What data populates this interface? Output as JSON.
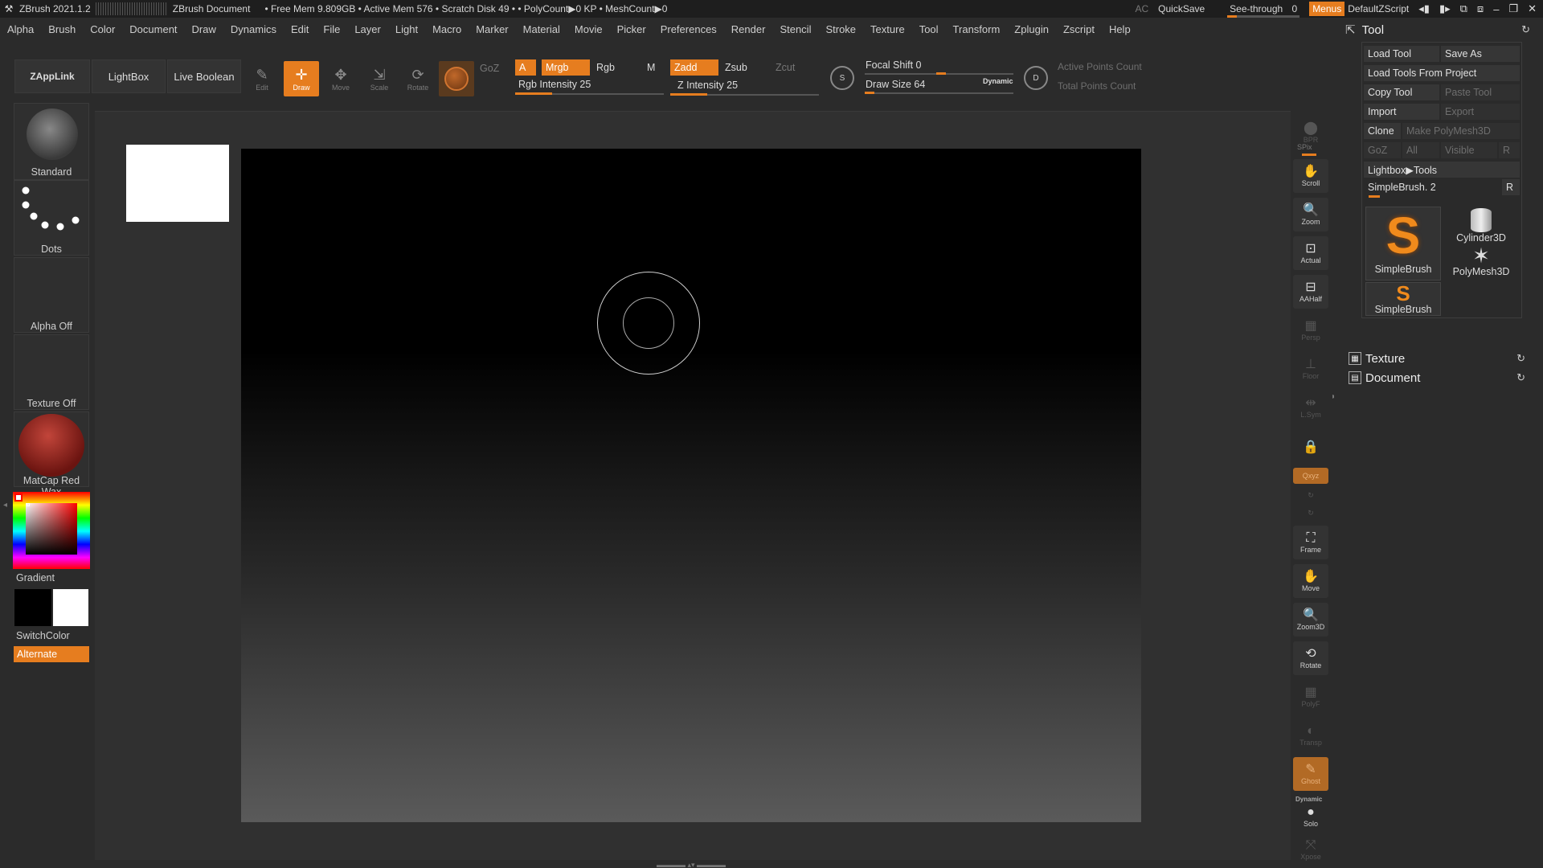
{
  "titlebar": {
    "app": "ZBrush 2021.1.2",
    "document": "ZBrush Document",
    "stats": "• Free Mem 9.809GB • Active Mem 576 • Scratch Disk 49 •  • PolyCount▶0 KP  • MeshCount▶0",
    "ac": "AC",
    "quicksave": "QuickSave",
    "seethrough": "See-through",
    "seethrough_value": "0",
    "seethrough_fraction": 0,
    "menus": "Menus",
    "script": "DefaultZScript"
  },
  "menubar": [
    "Alpha",
    "Brush",
    "Color",
    "Document",
    "Draw",
    "Dynamics",
    "Edit",
    "File",
    "Layer",
    "Light",
    "Macro",
    "Marker",
    "Material",
    "Movie",
    "Picker",
    "Preferences",
    "Render",
    "Stencil",
    "Stroke",
    "Texture",
    "Tool",
    "Transform",
    "Zplugin",
    "Zscript",
    "Help"
  ],
  "toolbar": {
    "zapplink": "ZAppLink",
    "lightbox": "LightBox",
    "liveboolean": "Live Boolean",
    "edit": "Edit",
    "draw": "Draw",
    "move": "Move",
    "scale": "Scale",
    "rotate": "Rotate",
    "goz": "GoZ",
    "a": "A",
    "mrgb": "Mrgb",
    "rgb": "Rgb",
    "m": "M",
    "zadd": "Zadd",
    "zsub": "Zsub",
    "zcut": "Zcut",
    "rgb_intensity": "Rgb Intensity 25",
    "rgb_intensity_value": 25,
    "z_intensity": "Z Intensity 25",
    "z_intensity_value": 25,
    "focal_shift": "Focal Shift 0",
    "focal_shift_value": 0,
    "draw_size": "Draw Size 64",
    "draw_size_value": 64,
    "dynamic": "Dynamic",
    "s_label": "S",
    "d_label": "D",
    "active_points": "Active Points Count",
    "total_points": "Total Points Count"
  },
  "leftpanel": {
    "brush": "Standard",
    "stroke": "Dots",
    "alpha": "Alpha Off",
    "texture": "Texture Off",
    "material": "MatCap Red Wax",
    "gradient": "Gradient",
    "switchcolor": "SwitchColor",
    "alternate": "Alternate"
  },
  "rshelf": {
    "bpr": "BPR",
    "spix": "SPix",
    "scroll": "Scroll",
    "zoom": "Zoom",
    "actual": "Actual",
    "aahalf": "AAHalf",
    "persp": "Persp",
    "floor": "Floor",
    "lsym": "L.Sym",
    "qxyz": "Qxyz",
    "frame": "Frame",
    "move": "Move",
    "zoom3d": "Zoom3D",
    "rotate": "Rotate",
    "polyf": "PolyF",
    "transp": "Transp",
    "ghost": "Ghost",
    "dynamic": "Dynamic",
    "solo": "Solo",
    "xpose": "Xpose"
  },
  "toolpal": {
    "title": "Tool",
    "load_tool": "Load Tool",
    "save_as": "Save As",
    "load_from_project": "Load Tools From Project",
    "copy_tool": "Copy Tool",
    "paste_tool": "Paste Tool",
    "import": "Import",
    "export": "Export",
    "clone": "Clone",
    "make_polymesh": "Make PolyMesh3D",
    "goz": "GoZ",
    "all": "All",
    "visible": "Visible",
    "r": "R",
    "lightbox_tools": "Lightbox▶Tools",
    "current_tool": "SimpleBrush. 2",
    "current_r": "R",
    "tools": [
      "SimpleBrush",
      "Cylinder3D",
      "PolyMesh3D",
      "SimpleBrush"
    ],
    "texture": "Texture",
    "document": "Document"
  },
  "colors": {
    "accent": "#e67d1f",
    "panel": "#2b2b2b",
    "canvas_top": "#000000"
  }
}
